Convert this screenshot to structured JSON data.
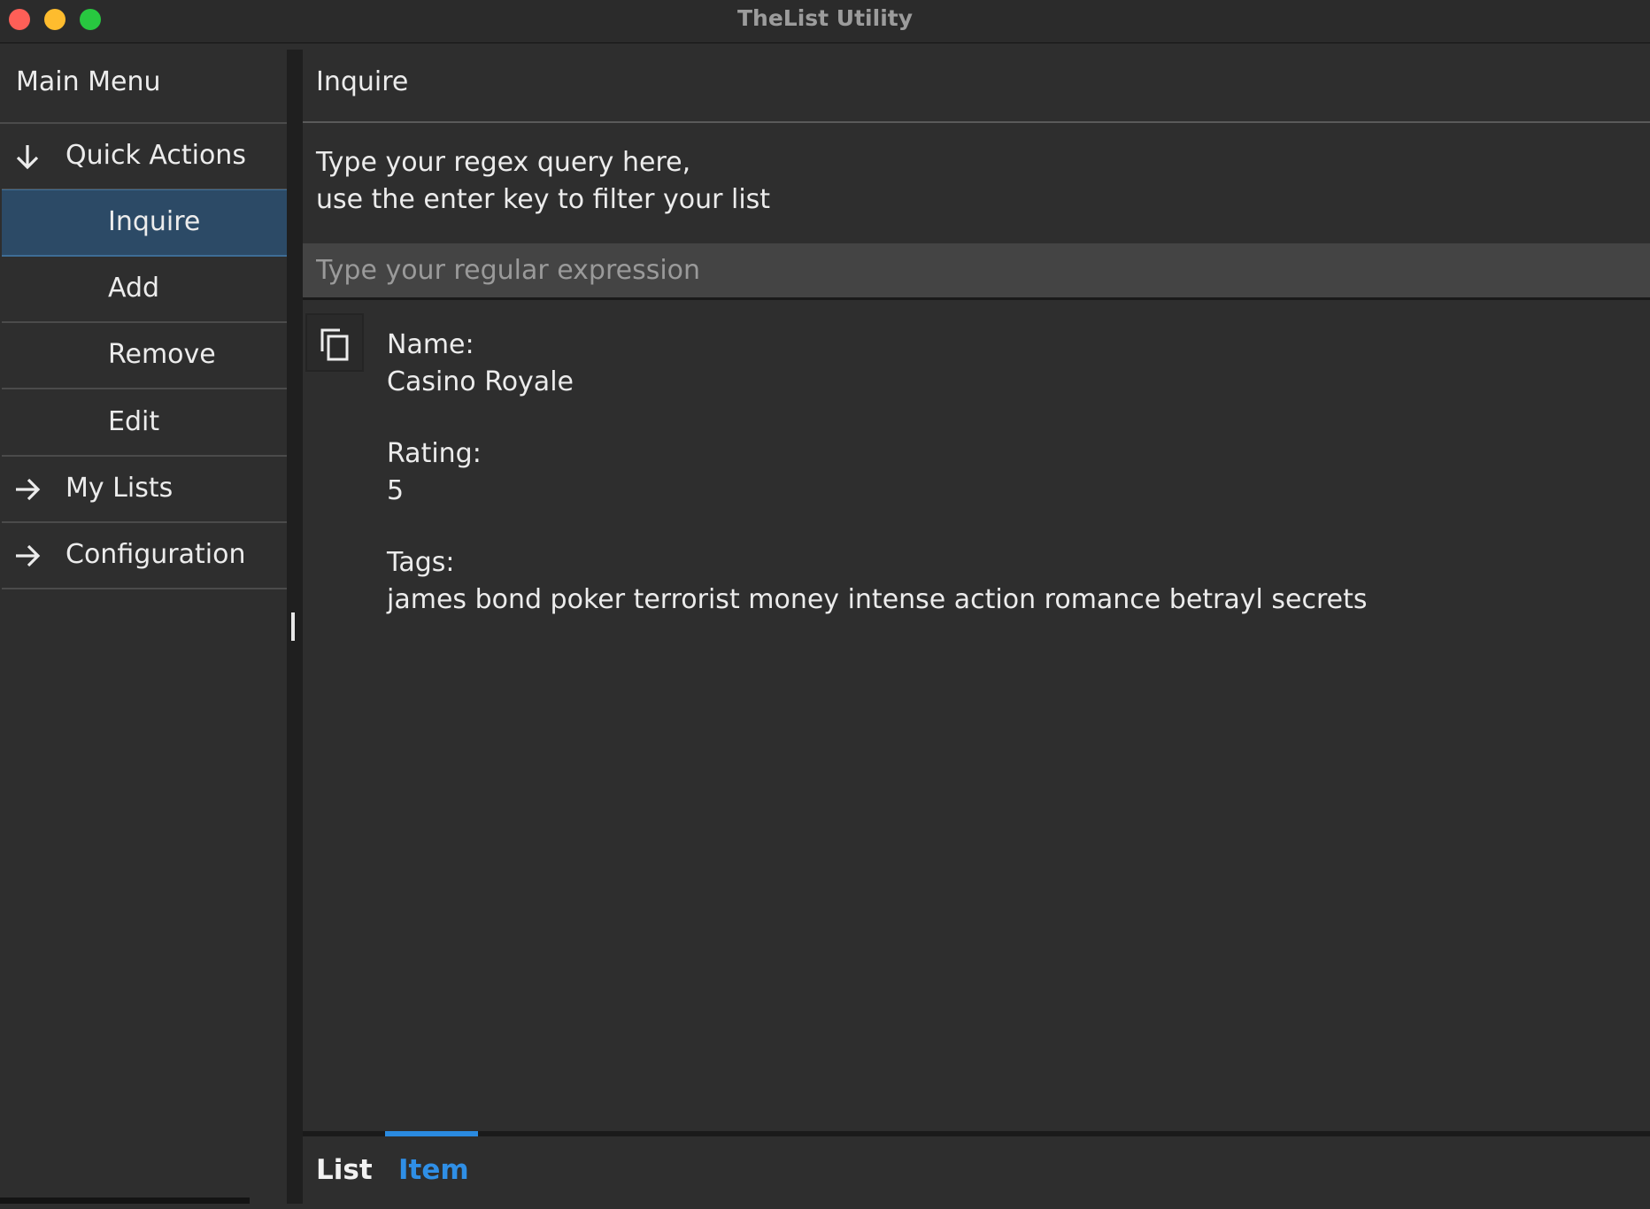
{
  "window": {
    "title": "TheList Utility"
  },
  "sidebar": {
    "title": "Main Menu",
    "items": [
      {
        "label": "Quick Actions",
        "icon": "arrow-down-icon",
        "expanded": true
      },
      {
        "label": "Inquire",
        "selected": true
      },
      {
        "label": "Add"
      },
      {
        "label": "Remove"
      },
      {
        "label": "Edit"
      },
      {
        "label": "My Lists",
        "icon": "arrow-right-icon"
      },
      {
        "label": "Configuration",
        "icon": "arrow-right-icon"
      }
    ]
  },
  "main": {
    "title": "Inquire",
    "instructions_line1": "Type your regex query here,",
    "instructions_line2": "use the enter key to filter your list",
    "search_placeholder": "Type your regular expression",
    "search_value": "",
    "item": {
      "name_label": "Name:",
      "name_value": "Casino Royale",
      "rating_label": "Rating:",
      "rating_value": "5",
      "tags_label": "Tags:",
      "tags_value": "james bond poker terrorist money intense action romance betrayl secrets"
    },
    "tabs": [
      {
        "label": "List",
        "active": false
      },
      {
        "label": "Item",
        "active": true
      }
    ]
  },
  "colors": {
    "accent": "#2a8ae0",
    "selected_bg": "#2c4a66"
  }
}
